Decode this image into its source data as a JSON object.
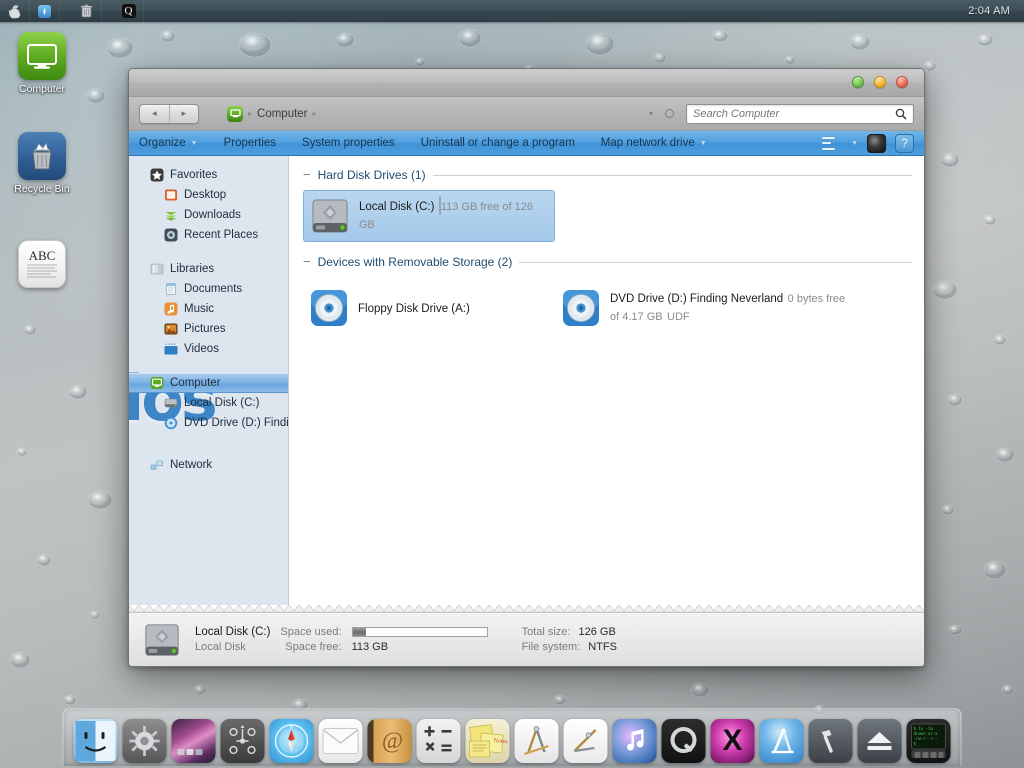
{
  "menubar": {
    "items": [
      {
        "name": "apple-menu-icon",
        "glyph": "apple"
      },
      {
        "name": "finder-blue-icon",
        "glyph": "compass"
      },
      {
        "name": "trash-icon",
        "glyph": "trash"
      },
      {
        "name": "spotlight-icon",
        "glyph": "Q"
      }
    ],
    "clock": "2:04 AM"
  },
  "desktop": {
    "icons": [
      {
        "label": "Computer",
        "icon": "computer-monitor-icon"
      },
      {
        "label": "Recycle Bin",
        "icon": "recycle-bin-icon"
      },
      {
        "label": "ABC",
        "icon": "text-document-icon"
      }
    ]
  },
  "window": {
    "controls": {
      "close": "#6fc44a",
      "minimize": "#f0b429",
      "maximize": "#e0674f"
    },
    "nav": {
      "back_glyph": "◂",
      "forward_glyph": "▸",
      "breadcrumb": [
        "Computer"
      ],
      "breadcrumb_sep": "▸",
      "history_caret": "▾"
    },
    "search": {
      "placeholder": "Search Computer",
      "value": "",
      "icon": "search-icon"
    },
    "commandbar": {
      "items": [
        {
          "label": "Organize",
          "has_caret": true
        },
        {
          "label": "Properties",
          "has_caret": false
        },
        {
          "label": "System properties",
          "has_caret": false
        },
        {
          "label": "Uninstall or change a program",
          "has_caret": false
        },
        {
          "label": "Map network drive",
          "has_caret": true
        }
      ],
      "right_icons": [
        "change-view-icon",
        "preview-pane-icon",
        "help-icon"
      ],
      "help_glyph": "?"
    },
    "sidebar": {
      "groups": [
        {
          "header": {
            "label": "Favorites",
            "icon": "favorites-star-icon"
          },
          "items": [
            {
              "label": "Desktop",
              "icon": "desktop-icon",
              "selected": false
            },
            {
              "label": "Downloads",
              "icon": "downloads-icon",
              "selected": false
            },
            {
              "label": "Recent Places",
              "icon": "recent-places-icon",
              "selected": false
            }
          ]
        },
        {
          "header": {
            "label": "Libraries",
            "icon": "libraries-icon"
          },
          "items": [
            {
              "label": "Documents",
              "icon": "documents-icon",
              "selected": false
            },
            {
              "label": "Music",
              "icon": "music-icon",
              "selected": false
            },
            {
              "label": "Pictures",
              "icon": "pictures-icon",
              "selected": false
            },
            {
              "label": "Videos",
              "icon": "videos-icon",
              "selected": false
            }
          ]
        },
        {
          "header": {
            "label": "Computer",
            "icon": "computer-icon",
            "selected": true
          },
          "items": [
            {
              "label": "Local Disk (C:)",
              "icon": "hard-disk-icon",
              "selected": false
            },
            {
              "label": "DVD Drive (D:) Finding",
              "icon": "dvd-drive-icon",
              "selected": false
            }
          ]
        },
        {
          "header": {
            "label": "Network",
            "icon": "network-icon"
          },
          "items": []
        }
      ],
      "watermark": "ios"
    },
    "content": {
      "groups": [
        {
          "title": "Hard Disk Drives (1)",
          "collapse_glyph": "−",
          "items": [
            {
              "name": "Local Disk (C:)",
              "icon": "hard-disk-icon",
              "has_bar": true,
              "bar_percent": 10,
              "sub": "113 GB free of 126 GB",
              "sub2": "",
              "selected": true
            }
          ]
        },
        {
          "title": "Devices with Removable Storage (2)",
          "collapse_glyph": "−",
          "items": [
            {
              "name": "Floppy Disk Drive (A:)",
              "icon": "optical-drive-icon",
              "has_bar": false,
              "bar_percent": 0,
              "sub": "",
              "sub2": "",
              "selected": false
            },
            {
              "name": "DVD Drive (D:) Finding Neverland",
              "icon": "optical-drive-icon",
              "has_bar": false,
              "bar_percent": 0,
              "sub": "0 bytes free of 4.17 GB",
              "sub2": "UDF",
              "selected": false
            }
          ]
        }
      ]
    },
    "details": {
      "icon": "hard-disk-icon",
      "title": "Local Disk (C:)",
      "subtitle": "Local Disk",
      "fields": [
        {
          "key": "Space used:",
          "value": ""
        },
        {
          "key": "Total size:",
          "value": "126 GB"
        },
        {
          "key": "Space free:",
          "value": "113 GB"
        },
        {
          "key": "File system:",
          "value": "NTFS"
        }
      ],
      "space_used_percent": 10
    }
  },
  "dock": {
    "items": [
      {
        "name": "finder-icon",
        "glyph": "finder"
      },
      {
        "name": "system-preferences-icon",
        "glyph": "gear"
      },
      {
        "name": "desktop-wallpaper-icon",
        "glyph": "aurora"
      },
      {
        "name": "dashboard-icon",
        "glyph": "dashboard"
      },
      {
        "name": "safari-icon",
        "glyph": "compass"
      },
      {
        "name": "mail-icon",
        "glyph": "envelope"
      },
      {
        "name": "address-book-icon",
        "glyph": "@"
      },
      {
        "name": "calculator-icon",
        "glyph": "calc"
      },
      {
        "name": "stickies-icon",
        "glyph": "sticky"
      },
      {
        "name": "dashcode-icon",
        "glyph": "compass-tool"
      },
      {
        "name": "interface-builder-icon",
        "glyph": "ruler"
      },
      {
        "name": "itunes-icon",
        "glyph": "note"
      },
      {
        "name": "quicktime-icon",
        "glyph": "Q"
      },
      {
        "name": "xcode-icon",
        "glyph": "X"
      },
      {
        "name": "app-store-icon",
        "glyph": "tools"
      },
      {
        "name": "hammer-icon",
        "glyph": "hammer"
      },
      {
        "name": "eject-icon",
        "glyph": "eject"
      },
      {
        "name": "terminal-icon",
        "glyph": "terminal"
      }
    ]
  }
}
